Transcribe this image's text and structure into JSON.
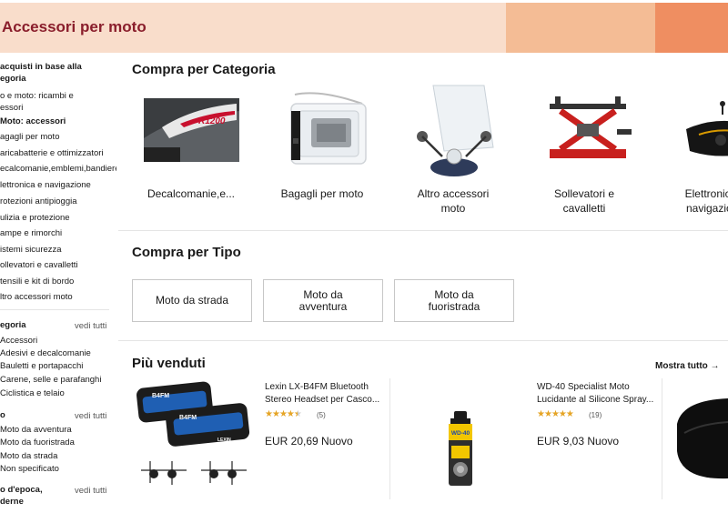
{
  "banner": {
    "title": "Accessori per moto"
  },
  "sidebar": {
    "section_title": "acquisti in base alla\negoria",
    "items": [
      "o e moto: ricambi e\nessori",
      "Moto: accessori",
      "agagli per moto",
      "aricabatterie e ottimizzatori",
      "ecalcomanie,emblemi,bandiere",
      "lettronica e navigazione",
      "rotezioni antipioggia",
      "ulizia e protezione",
      "ampe e rimorchi",
      "istemi sicurezza",
      "ollevatori e cavalletti",
      "tensili e kit di bordo",
      "ltro accessori moto"
    ],
    "filters": [
      {
        "heading": "egoria",
        "link": "vedi tutti",
        "options": [
          "Accessori",
          "Adesivi e decalcomanie",
          "Bauletti e portapacchi",
          "Carene, selle e parafanghi",
          "Ciclistica e telaio"
        ]
      },
      {
        "heading": "o",
        "link": "vedi tutti",
        "options": [
          "Moto da avventura",
          "Moto da fuoristrada",
          "Moto da strada",
          "Non specificato"
        ]
      },
      {
        "heading": "o d'epoca,\nderne",
        "link": "vedi tutti",
        "options": []
      }
    ]
  },
  "categories": {
    "title": "Compra per Categoria",
    "items": [
      {
        "label": "Decalcomanie,e..."
      },
      {
        "label": "Bagagli per moto"
      },
      {
        "label": "Altro accessori\nmoto"
      },
      {
        "label": "Sollevatori e\ncavalletti"
      },
      {
        "label": "Elettronica e\nnavigazione"
      }
    ],
    "decal_text": "R1200"
  },
  "types": {
    "title": "Compra per Tipo",
    "items": [
      {
        "label": "Moto da strada"
      },
      {
        "label": "Moto da avventura"
      },
      {
        "label": "Moto da fuoristrada"
      }
    ]
  },
  "bestsellers": {
    "title": "Più venduti",
    "see_all": "Mostra tutto →",
    "products": [
      {
        "title": "Lexin LX-B4FM Bluetooth Stereo Headset per Casco...",
        "rating": 4.5,
        "stars": "★★★★★",
        "reviews": "(5)",
        "price": "EUR 20,69 Nuovo",
        "brand_text": "B4FM",
        "logo": "LEXIN"
      },
      {
        "title": "WD-40 Specialist Moto Lucidante al Silicone Spray...",
        "rating": 5,
        "stars": "★★★★★",
        "reviews": "(19)",
        "price": "EUR 9,03 Nuovo",
        "brand_text": "WD-40"
      }
    ]
  },
  "colors": {
    "banner_bg": "#f9ddcb",
    "banner_accent1": "#f4bc95",
    "banner_accent2": "#ef8e61",
    "banner_title": "#8a1e2c",
    "star": "#e5a425"
  }
}
